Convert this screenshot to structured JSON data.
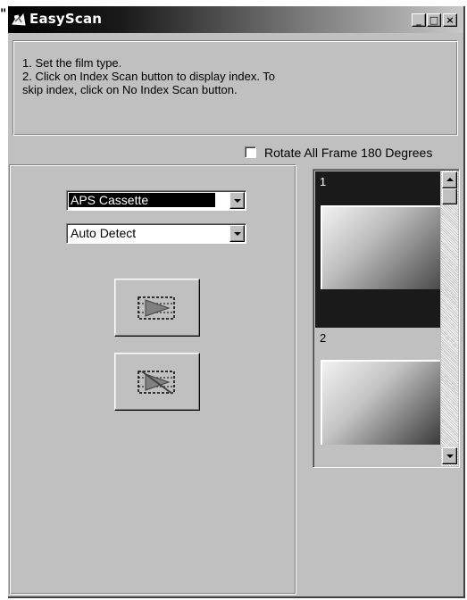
{
  "window": {
    "stray_char": "\"",
    "title": "EasyScan",
    "controls": {
      "minimize": "_",
      "maximize": "□",
      "close": "×"
    },
    "icon": "easyscan-app-icon"
  },
  "instructions": {
    "line1": "1. Set the film type.",
    "line2": "2. Click on Index Scan button to display index. To",
    "line3": "skip index, click on No Index Scan button."
  },
  "rotate_option": {
    "label": "Rotate All Frame 180 Degrees",
    "checked": false
  },
  "film_type": {
    "selected": "APS Cassette"
  },
  "detect_mode": {
    "selected": "Auto Detect"
  },
  "buttons": {
    "index_scan": {
      "icon": "index-scan-icon"
    },
    "no_index_scan": {
      "icon": "no-index-scan-icon"
    }
  },
  "thumbnails": {
    "frames": [
      {
        "number": "1",
        "selected": true
      },
      {
        "number": "2",
        "selected": false
      }
    ]
  },
  "colors": {
    "face": "#c0c0c0",
    "selection": "#000000",
    "title_gradient_start": "#000000",
    "title_gradient_end": "#c8c8c8"
  }
}
